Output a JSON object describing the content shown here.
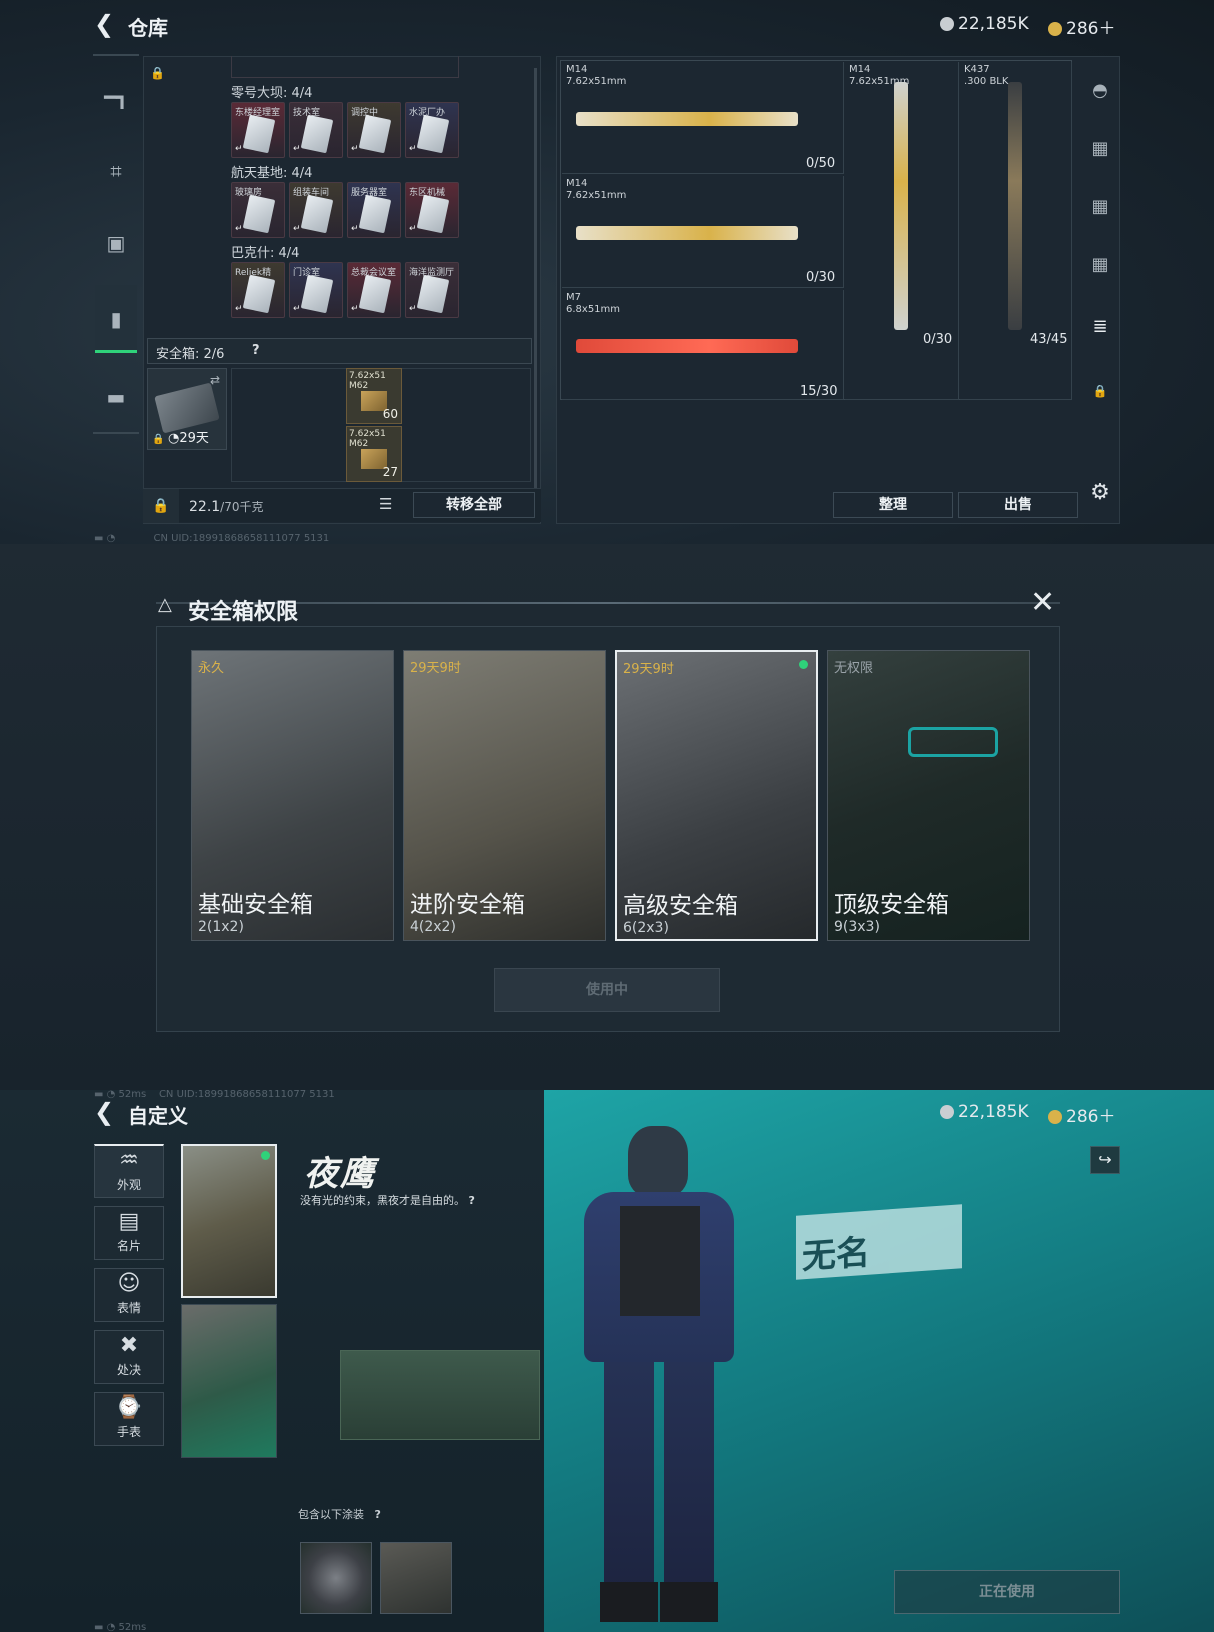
{
  "colors": {
    "gold": "#d9b24a",
    "green": "#2fd27a",
    "teal": "#1ba3a3",
    "red": "#e04a3a"
  },
  "warehouse": {
    "title": "仓库",
    "back_icon": "chevron-left-icon",
    "currency_silver": "22,185K",
    "currency_gold": "286＋",
    "groups": [
      {
        "label": "零号大坝: 4/4",
        "items": [
          "东楼经理室",
          "技术室",
          "调控中",
          "水泥厂办"
        ]
      },
      {
        "label": "航天基地: 4/4",
        "items": [
          "玻璃房",
          "组装车间",
          "服务器室",
          "东区机械"
        ]
      },
      {
        "label": "巴克什: 4/4",
        "items": [
          "Reliek精",
          "门诊室",
          "总裁会议室",
          "海洋监测厅"
        ]
      }
    ],
    "safebox_label": "安全箱: 2/6",
    "help_mark": "?",
    "safebox_days": "29天",
    "ammo": [
      {
        "label": "7.62x51\nM62",
        "count": "60"
      },
      {
        "label": "7.62x51\nM62",
        "count": "27"
      }
    ],
    "weight_value": "22.1",
    "weight_unit": "/70千克",
    "transfer_all": "转移全部",
    "weapons": [
      {
        "name": "M14",
        "caliber": "7.62x51mm",
        "count": "0/50"
      },
      {
        "name": "M14",
        "caliber": "7.62x51mm",
        "count": "0/30"
      },
      {
        "name": "M7",
        "caliber": "6.8x51mm",
        "count": "15/30"
      },
      {
        "name": "M14",
        "caliber": "7.62x51mm",
        "count": "0/30"
      },
      {
        "name": "K437",
        "caliber": ".300 BLK",
        "count": "43/45"
      }
    ],
    "sort_button": "整理",
    "sell_button": "出售",
    "status_uid": "CN UID:18991868658111077 5131"
  },
  "safebox_modal": {
    "title": "安全箱权限",
    "options": [
      {
        "tag": "永久",
        "name": "基础安全箱",
        "size": "2(1x2)"
      },
      {
        "tag": "29天9时",
        "name": "进阶安全箱",
        "size": "4(2x2)"
      },
      {
        "tag": "29天9时",
        "name": "高级安全箱",
        "size": "6(2x3)"
      },
      {
        "tag": "无权限",
        "name": "顶级安全箱",
        "size": "9(3x3)"
      }
    ],
    "in_use": "使用中"
  },
  "customize": {
    "status_ping": "52ms",
    "status_uid": "CN UID:18991868658111077 5131",
    "title": "自定义",
    "currency_silver": "22,185K",
    "currency_gold": "286＋",
    "nav": [
      "外观",
      "名片",
      "表情",
      "处决",
      "手表"
    ],
    "skin_name": "夜鹰",
    "skin_quote": "没有光的约束，黑夜才是自由的。",
    "includes_label": "包含以下涂装",
    "help_mark": "?",
    "wall_text": "无名",
    "in_use_button": "正在使用"
  }
}
